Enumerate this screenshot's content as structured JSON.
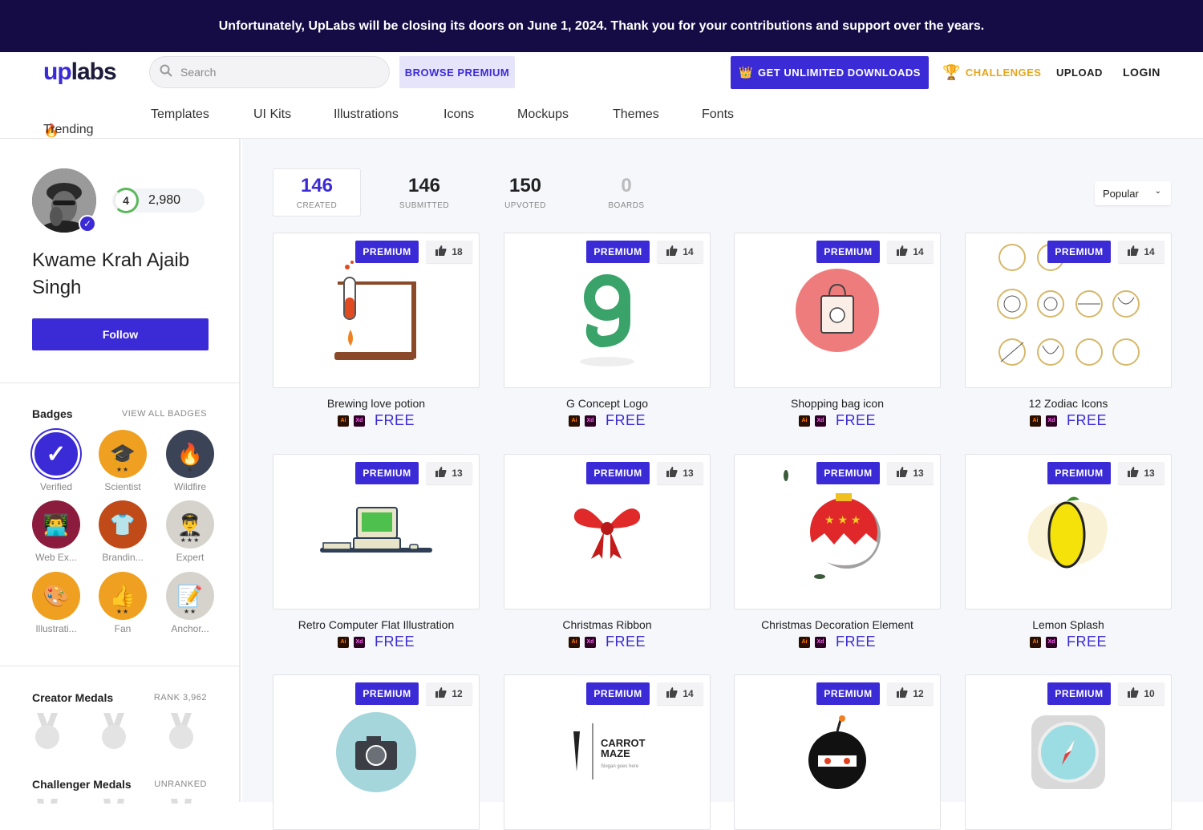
{
  "banner": "Unfortunately, UpLabs will be closing its doors on June 1, 2024. Thank you for your contributions and support over the years.",
  "header": {
    "logo_up": "up",
    "logo_labs": "labs",
    "search_placeholder": "Search",
    "browse_premium": "BROWSE PREMIUM",
    "unlimited": "GET UNLIMITED DOWNLOADS",
    "challenges": "CHALLENGES",
    "upload": "UPLOAD",
    "login": "LOGIN"
  },
  "categories": [
    "Trending",
    "Templates",
    "UI Kits",
    "Illustrations",
    "Icons",
    "Mockups",
    "Themes",
    "Fonts"
  ],
  "profile": {
    "level": "4",
    "points": "2,980",
    "name": "Kwame Krah Ajaib Singh",
    "follow": "Follow"
  },
  "badges": {
    "title": "Badges",
    "view_all": "VIEW ALL BADGES",
    "items": [
      {
        "label": "Verified",
        "icon": "checkmark",
        "color": "#3b2bd6"
      },
      {
        "label": "Scientist",
        "icon": "graduation-cap",
        "color": "#f0a020"
      },
      {
        "label": "Wildfire",
        "icon": "fire",
        "color": "#3b4356"
      },
      {
        "label": "Web Ex...",
        "icon": "developer",
        "color": "#8b1c3e"
      },
      {
        "label": "Brandin...",
        "icon": "t-shirt",
        "color": "#c04a18"
      },
      {
        "label": "Expert",
        "icon": "pilot",
        "color": "#d6d3cc"
      },
      {
        "label": "Illustrati...",
        "icon": "palette",
        "color": "#f0a020"
      },
      {
        "label": "Fan",
        "icon": "thumbs-up",
        "color": "#f0a020"
      },
      {
        "label": "Anchor...",
        "icon": "pencil-note",
        "color": "#d6d3cc"
      }
    ]
  },
  "creator_medals": {
    "title": "Creator Medals",
    "rank": "RANK 3,962"
  },
  "challenger_medals": {
    "title": "Challenger Medals",
    "rank": "UNRANKED"
  },
  "stats": [
    {
      "num": "146",
      "label": "CREATED"
    },
    {
      "num": "146",
      "label": "SUBMITTED"
    },
    {
      "num": "150",
      "label": "UPVOTED"
    },
    {
      "num": "0",
      "label": "BOARDS"
    }
  ],
  "sort": "Popular",
  "premium_label": "PREMIUM",
  "free_label": "FREE",
  "ai_label": "Ai",
  "xd_label": "Xd",
  "items": [
    {
      "title": "Brewing love potion",
      "likes": "18"
    },
    {
      "title": "G Concept Logo",
      "likes": "14"
    },
    {
      "title": "Shopping bag icon",
      "likes": "14"
    },
    {
      "title": "12 Zodiac Icons",
      "likes": "14"
    },
    {
      "title": "Retro Computer Flat Illustration",
      "likes": "13"
    },
    {
      "title": "Christmas Ribbon",
      "likes": "13"
    },
    {
      "title": "Christmas Decoration Element",
      "likes": "13"
    },
    {
      "title": "Lemon Splash",
      "likes": "13"
    },
    {
      "title": "",
      "likes": "12"
    },
    {
      "title": "",
      "likes": "14",
      "art_text1": "CARROT",
      "art_text2": "MAZE",
      "art_text3": "Slogan goes here"
    },
    {
      "title": "",
      "likes": "12"
    },
    {
      "title": "",
      "likes": "10"
    }
  ]
}
